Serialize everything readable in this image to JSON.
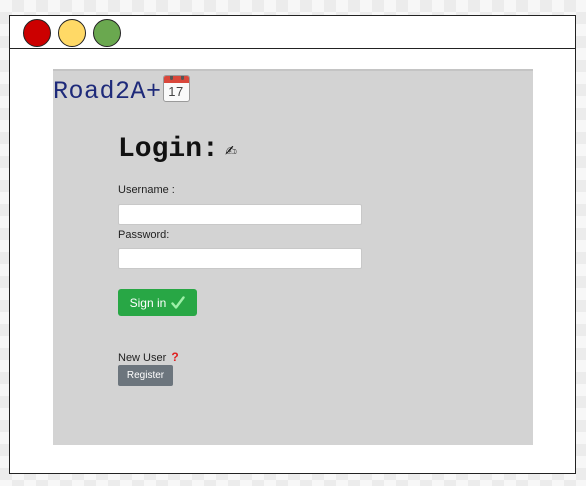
{
  "window": {
    "controls": {
      "close_color": "#cc0000",
      "minimize_color": "#ffd966",
      "maximize_color": "#6aa84f"
    }
  },
  "brand": {
    "text": "Road2A+",
    "icon": "calendar-icon",
    "icon_number": "17"
  },
  "login": {
    "title": "Login:",
    "title_icon": "writing-hand-icon",
    "title_glyph": "✍"
  },
  "form": {
    "username_label": "Username :",
    "username_value": "",
    "password_label": "Password:",
    "password_value": "",
    "signin_label": "Sign in",
    "signin_icon": "checkmark-icon",
    "signin_color": "#28a745"
  },
  "register": {
    "prompt": "New User",
    "prompt_icon": "question-mark-icon",
    "prompt_glyph": "?",
    "button_label": "Register",
    "button_color": "#6c757d"
  }
}
